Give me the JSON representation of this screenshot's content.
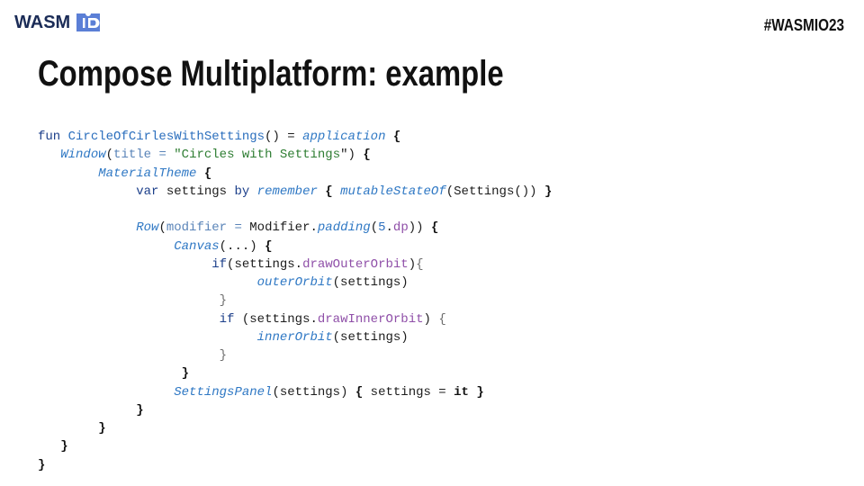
{
  "brand": {
    "logo_text": "WASM",
    "logo_color": "#1b2c57",
    "accent_color": "#5b7fd6"
  },
  "hashtag": "#WASMIO23",
  "slide": {
    "title": "Compose Multiplatform: example"
  },
  "code": {
    "language": "kotlin",
    "lines": [
      {
        "indent": 0,
        "tokens": [
          [
            "kw",
            "fun "
          ],
          [
            "fn",
            "CircleOfCirlesWithSettings"
          ],
          [
            "pu",
            "() = "
          ],
          [
            "it",
            "application"
          ],
          [
            "pu",
            " "
          ],
          [
            "br",
            "{"
          ]
        ]
      },
      {
        "indent": 3,
        "tokens": [
          [
            "it",
            "Window"
          ],
          [
            "pu",
            "("
          ],
          [
            "pa",
            "title = "
          ],
          [
            "st",
            "\"Circles with Settings"
          ],
          [
            "pu",
            "\") "
          ],
          [
            "br",
            "{"
          ]
        ]
      },
      {
        "indent": 8,
        "tokens": [
          [
            "it",
            "MaterialTheme"
          ],
          [
            "pu",
            " "
          ],
          [
            "br",
            "{"
          ]
        ]
      },
      {
        "indent": 13,
        "tokens": [
          [
            "kw",
            "var "
          ],
          [
            "pu",
            "settings "
          ],
          [
            "kw",
            "by "
          ],
          [
            "it",
            "remember"
          ],
          [
            "pu",
            " "
          ],
          [
            "br",
            "{"
          ],
          [
            "pu",
            " "
          ],
          [
            "it",
            "mutableStateOf"
          ],
          [
            "pu",
            "(Settings()) "
          ],
          [
            "br",
            "}"
          ]
        ]
      },
      {
        "indent": 0,
        "tokens": []
      },
      {
        "indent": 13,
        "tokens": [
          [
            "it",
            "Row"
          ],
          [
            "pu",
            "("
          ],
          [
            "pa",
            "modifier = "
          ],
          [
            "pu",
            "Modifier."
          ],
          [
            "it",
            "padding"
          ],
          [
            "pu",
            "("
          ],
          [
            "nu",
            "5"
          ],
          [
            "pu",
            "."
          ],
          [
            "pr",
            "dp"
          ],
          [
            "pu",
            ")) "
          ],
          [
            "br",
            "{"
          ]
        ]
      },
      {
        "indent": 18,
        "tokens": [
          [
            "it",
            "Canvas"
          ],
          [
            "pu",
            "(...) "
          ],
          [
            "br",
            "{"
          ]
        ]
      },
      {
        "indent": 23,
        "tokens": [
          [
            "kw",
            "if"
          ],
          [
            "pu",
            "(settings."
          ],
          [
            "pr",
            "drawOuterOrbit"
          ],
          [
            "pu",
            ")"
          ],
          [
            "lb",
            "{"
          ]
        ]
      },
      {
        "indent": 29,
        "tokens": [
          [
            "it",
            "outerOrbit"
          ],
          [
            "pu",
            "(settings)"
          ]
        ]
      },
      {
        "indent": 24,
        "tokens": [
          [
            "lb",
            "}"
          ]
        ]
      },
      {
        "indent": 24,
        "tokens": [
          [
            "kw",
            "if "
          ],
          [
            "pu",
            "(settings."
          ],
          [
            "pr",
            "drawInnerOrbit"
          ],
          [
            "pu",
            ") "
          ],
          [
            "lb",
            "{"
          ]
        ]
      },
      {
        "indent": 29,
        "tokens": [
          [
            "it",
            "innerOrbit"
          ],
          [
            "pu",
            "(settings)"
          ]
        ]
      },
      {
        "indent": 24,
        "tokens": [
          [
            "lb",
            "}"
          ]
        ]
      },
      {
        "indent": 19,
        "tokens": [
          [
            "br",
            "}"
          ]
        ]
      },
      {
        "indent": 18,
        "tokens": [
          [
            "it",
            "SettingsPanel"
          ],
          [
            "pu",
            "(settings) "
          ],
          [
            "br",
            "{"
          ],
          [
            "pu",
            " settings = "
          ],
          [
            "bd",
            "it"
          ],
          [
            "pu",
            " "
          ],
          [
            "br",
            "}"
          ]
        ]
      },
      {
        "indent": 13,
        "tokens": [
          [
            "br",
            "}"
          ]
        ]
      },
      {
        "indent": 8,
        "tokens": [
          [
            "br",
            "}"
          ]
        ]
      },
      {
        "indent": 3,
        "tokens": [
          [
            "br",
            "}"
          ]
        ]
      },
      {
        "indent": 0,
        "tokens": [
          [
            "br",
            "}"
          ]
        ]
      }
    ]
  }
}
